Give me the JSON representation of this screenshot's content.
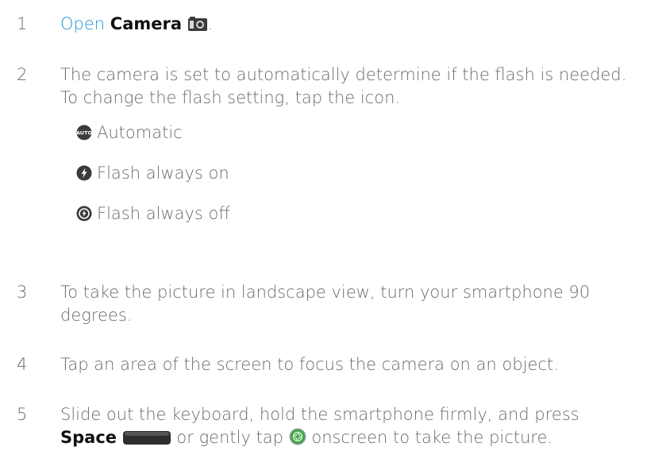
{
  "steps": [
    {
      "number": "1",
      "link_text": "Open",
      "app_name": "Camera",
      "end": "."
    },
    {
      "number": "2",
      "lines": [
        "The camera is set to automatically determine if the flash is needed.",
        "To change the flash setting, tap the icon."
      ],
      "options": [
        {
          "icon": "flash-auto-icon",
          "label": "Automatic"
        },
        {
          "icon": "flash-on-icon",
          "label": "Flash always on"
        },
        {
          "icon": "flash-off-icon",
          "label": "Flash always off"
        }
      ]
    },
    {
      "number": "3",
      "lines": [
        "To take the picture in landscape view, turn your smartphone 90",
        "degrees."
      ]
    },
    {
      "number": "4",
      "lines": [
        "Tap an area of the screen to focus the camera on an object."
      ]
    },
    {
      "number": "5",
      "line1": "Slide out the keyboard, hold the smartphone firmly, and press",
      "key_name": "Space",
      "mid": "or gently tap",
      "end": "onscreen to take the picture."
    }
  ],
  "colors": {
    "text": "#6b6b6b",
    "link": "#1a9bd7",
    "bold": "#111111",
    "shutter_green": "#3aa54a"
  }
}
